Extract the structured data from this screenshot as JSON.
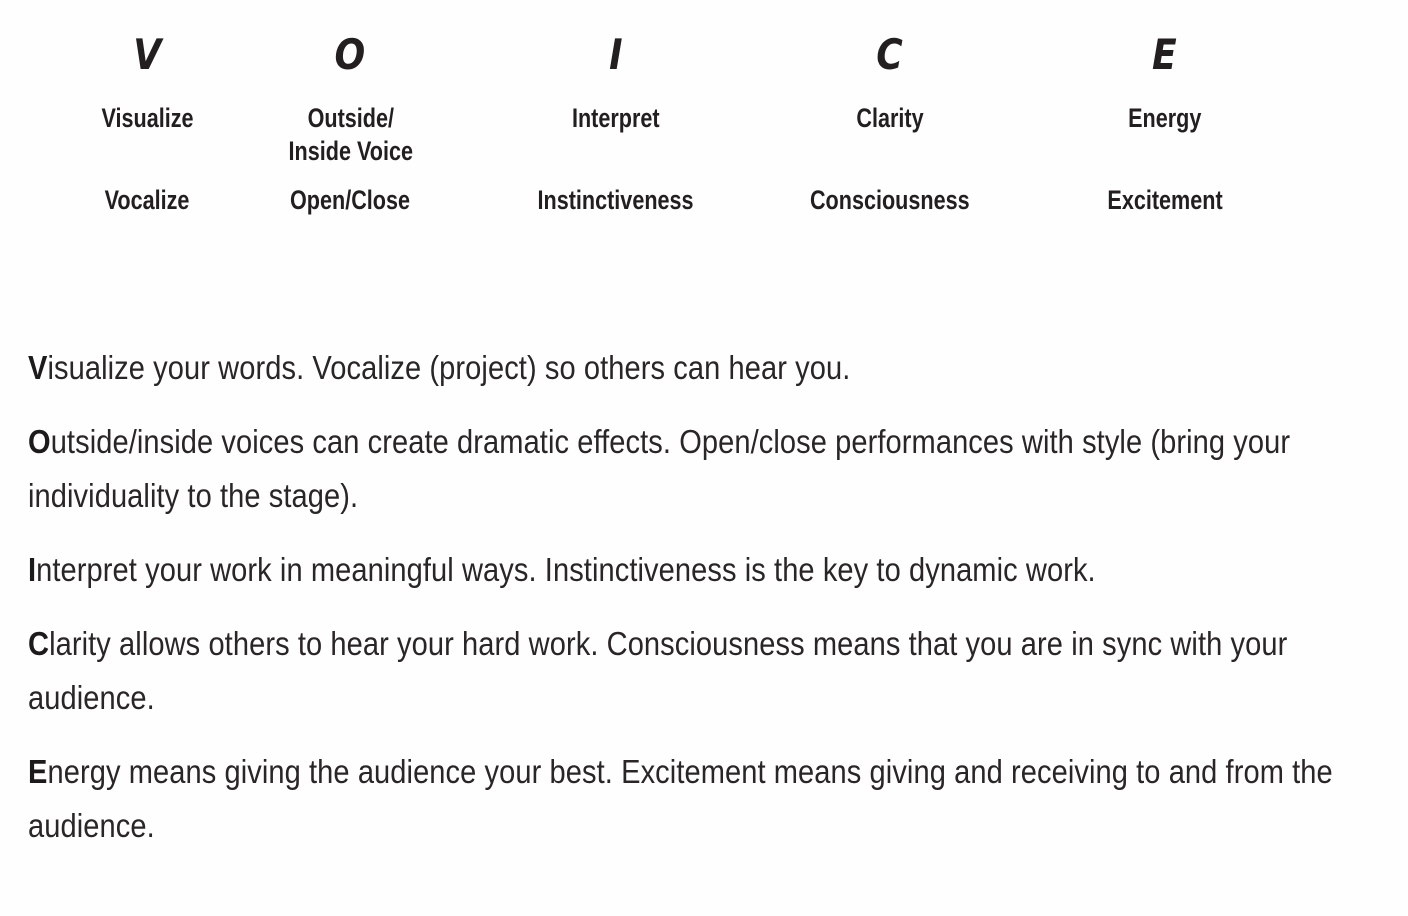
{
  "acronym": {
    "columns": [
      {
        "letter": "V",
        "primary": "Visualize",
        "secondary": "Vocalize"
      },
      {
        "letter": "O",
        "primary": "Outside/\nInside Voice",
        "secondary": "Open/Close"
      },
      {
        "letter": "I",
        "primary": "Interpret",
        "secondary": "Instinctiveness"
      },
      {
        "letter": "C",
        "primary": "Clarity",
        "secondary": "Consciousness"
      },
      {
        "letter": "E",
        "primary": "Energy",
        "secondary": "Excitement"
      }
    ]
  },
  "paragraphs": [
    {
      "initial": "V",
      "rest": "isualize your words. Vocalize (project) so others can hear you."
    },
    {
      "initial": "O",
      "rest": "utside/inside voices can create dramatic effects. Open/close performances with style (bring your individuality to the stage)."
    },
    {
      "initial": "I",
      "rest": "nterpret your work in meaningful ways. Instinctiveness is the key to dynamic work."
    },
    {
      "initial": "C",
      "rest": "larity allows others to hear your hard work. Consciousness means that you are in sync with your audience."
    },
    {
      "initial": "E",
      "rest": "nergy means giving the audience your best. Excitement means giving and receiving to and from the audience."
    }
  ],
  "colors": {
    "text": "#231f20",
    "body_text": "#2a2527",
    "background": "#ffffff"
  }
}
